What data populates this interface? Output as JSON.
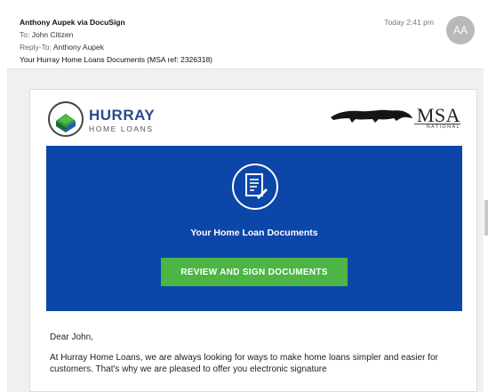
{
  "header": {
    "from": "Anthony Aupek via DocuSign",
    "to_label": "To:",
    "to_value": "John Citizen",
    "reply_label": "Reply-To:",
    "reply_value": "Anthony Aupek",
    "subject": "Your Hurray Home Loans Documents (MSA ref: 2326318)",
    "time": "Today 2:41 pm",
    "avatar_initials": "AA"
  },
  "logos": {
    "hurray_name": "HURRAY",
    "hurray_sub": "HOME LOANS",
    "msa_name": "MSA",
    "msa_sub": "NATIONAL"
  },
  "hero": {
    "icon": "document-pen-icon",
    "title": "Your Home Loan Documents",
    "button_label": "REVIEW AND SIGN DOCUMENTS",
    "background_color": "#0c46a8",
    "button_color": "#4db546"
  },
  "body": {
    "greeting": "Dear John,",
    "paragraph": "At Hurray Home Loans, we are always looking for ways to make home loans simpler and easier for customers. That's why we are pleased to offer you electronic signature"
  }
}
